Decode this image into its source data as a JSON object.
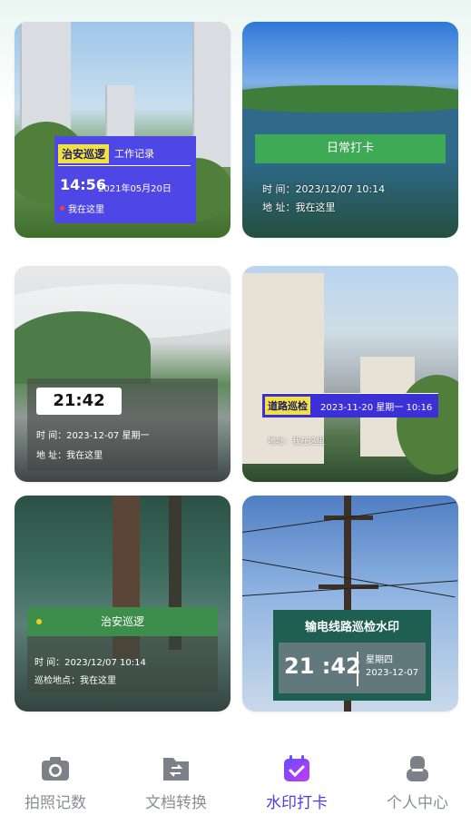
{
  "cards": [
    {
      "tag": "治安巡逻",
      "subtitle": "工作记录",
      "time": "14:56",
      "date": "2021年05月20日",
      "location": "我在这里"
    },
    {
      "title": "日常打卡",
      "time_row": "时    间：2023/12/07 10:14",
      "addr_row": "地    址：我在这里"
    },
    {
      "clock": "21:42",
      "time_row": "时    间：2023-12-07  星期一",
      "addr_row": "地    址：我在这里"
    },
    {
      "tag": "道路巡检",
      "datetime": "2023-11-20 星期一 10:16",
      "addr_row": "地址：我在这里"
    },
    {
      "title": "治安巡逻",
      "time_row": "时      间：2023/12/07 10:14",
      "place_row": "巡检地点：我在这里"
    },
    {
      "title": "输电线路巡检水印",
      "clock": "21 :42",
      "weekday": "星期四",
      "date": "2023-12-07"
    }
  ],
  "nav": {
    "items": [
      {
        "label": "拍照记数",
        "icon": "camera-icon"
      },
      {
        "label": "文档转换",
        "icon": "document-convert-icon"
      },
      {
        "label": "水印打卡",
        "icon": "calendar-check-icon"
      },
      {
        "label": "个人中心",
        "icon": "user-icon"
      }
    ],
    "active_index": 2,
    "active_color": "#4a3df0",
    "inactive_color": "#8a8f96"
  }
}
